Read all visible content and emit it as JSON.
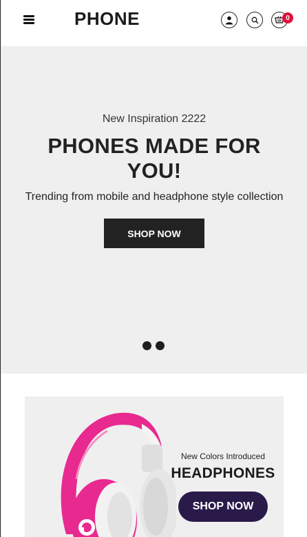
{
  "header": {
    "logo": "PHONE",
    "cart_count": "0",
    "icons": [
      "menu-icon",
      "user-icon",
      "search-icon",
      "cart-icon"
    ]
  },
  "hero": {
    "subtitle": "New Inspiration 2222",
    "title": "PHONES MADE FOR YOU!",
    "description": "Trending from mobile and headphone style collection",
    "button_label": "SHOP NOW",
    "background": "#efefef",
    "button_color": "#222222"
  },
  "promo": {
    "subtitle": "New Colors Introduced",
    "title": "HEADPHONES",
    "button_label": "SHOP NOW",
    "button_color": "#2a1a4a",
    "image": "pink-headphones"
  },
  "colors": {
    "badge": "#e0103a"
  }
}
